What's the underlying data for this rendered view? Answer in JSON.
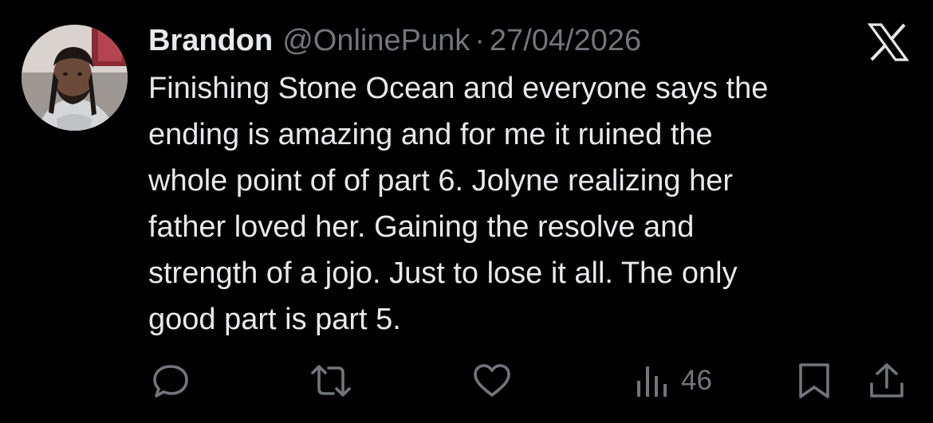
{
  "tweet": {
    "author_name": "Brandon",
    "handle": "@OnlinePunk",
    "separator": "·",
    "date": "27/04/2026",
    "text": "Finishing Stone Ocean and everyone says the\nending is amazing and for me it ruined the\nwhole point of of part 6. Jolyne realizing her\nfather loved her. Gaining the resolve and\nstrength of a jojo. Just to lose it all. The only\ngood part is part 5.",
    "views": "46"
  },
  "icons": {
    "brand": "x-logo-icon",
    "reply": "reply-icon",
    "retweet": "retweet-icon",
    "like": "heart-icon",
    "views": "views-icon",
    "bookmark": "bookmark-icon",
    "share": "share-icon"
  },
  "colors": {
    "background": "#000000",
    "primary_text": "#e7e9ea",
    "secondary_text": "#71767b"
  }
}
